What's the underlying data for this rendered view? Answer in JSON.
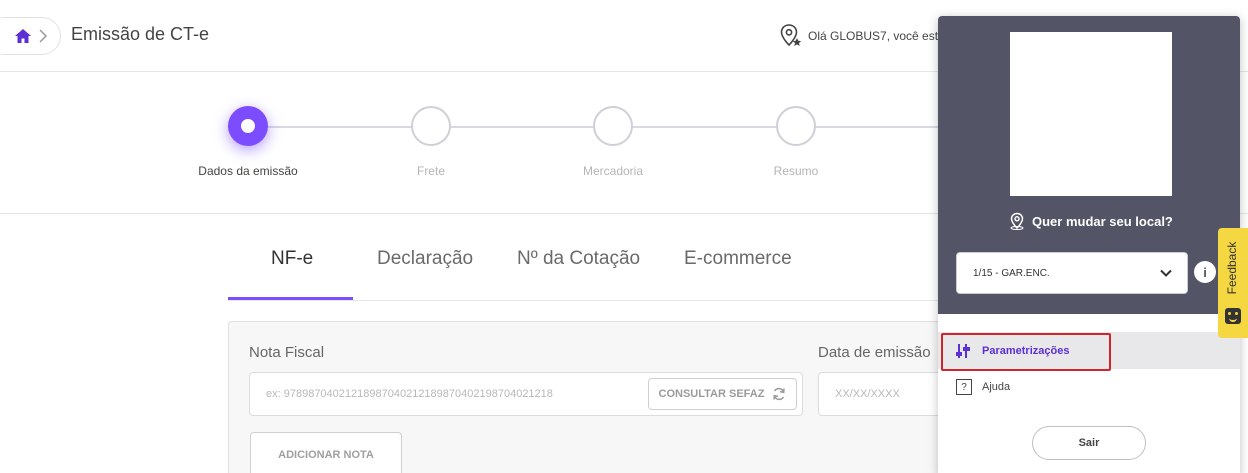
{
  "header": {
    "page_title": "Emissão de CT-e",
    "greeting": "Olá GLOBUS7, você est"
  },
  "stepper": {
    "steps": [
      {
        "label": "Dados da emissão",
        "active": true
      },
      {
        "label": "Frete",
        "active": false
      },
      {
        "label": "Mercadoria",
        "active": false
      },
      {
        "label": "Resumo",
        "active": false
      }
    ]
  },
  "tabs": [
    {
      "label": "NF-e",
      "active": true
    },
    {
      "label": "Declaração",
      "active": false
    },
    {
      "label": "Nº da Cotação",
      "active": false
    },
    {
      "label": "E-commerce",
      "active": false
    }
  ],
  "form": {
    "nota_fiscal_label": "Nota Fiscal",
    "nota_fiscal_placeholder": "ex: 97898704021218987040212189870402198704021218",
    "consultar_sefaz_label": "CONSULTAR SEFAZ",
    "data_emissao_label": "Data de emissão",
    "data_emissao_placeholder": "XX/XX/XXXX",
    "adicionar_nota_label": "ADICIONAR NOTA"
  },
  "panel": {
    "change_local": "Quer mudar seu local?",
    "selected_local": "1/15 - GAR.ENC.",
    "info_icon": "i",
    "menu": {
      "parametrizacoes": "Parametrizações",
      "ajuda": "Ajuda",
      "help_glyph": "?"
    },
    "sair": "Sair"
  },
  "feedback": {
    "label": "Feedback"
  },
  "colors": {
    "accent": "#7c4dff",
    "panel_bg": "#535566",
    "highlight": "#d0262b",
    "feedback_bg": "#f5d742"
  }
}
